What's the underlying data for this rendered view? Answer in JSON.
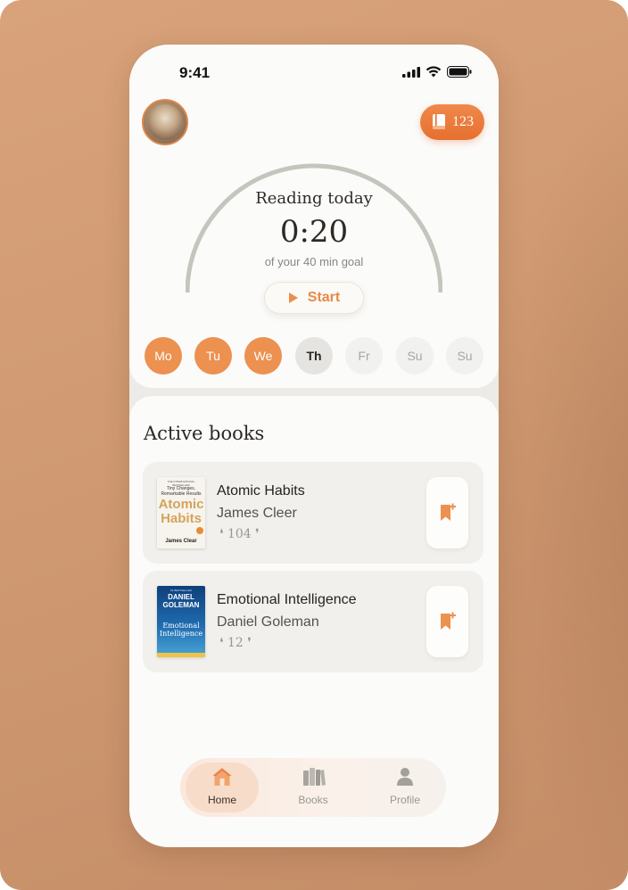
{
  "status_bar": {
    "time": "9:41"
  },
  "header": {
    "books_count": "123"
  },
  "reading": {
    "label": "Reading today",
    "time": "0:20",
    "goal_text": "of your 40 min goal",
    "progress_fraction": 0.5,
    "start_label": "Start"
  },
  "days": [
    {
      "label": "Mo",
      "state": "done"
    },
    {
      "label": "Tu",
      "state": "done"
    },
    {
      "label": "We",
      "state": "done"
    },
    {
      "label": "Th",
      "state": "today"
    },
    {
      "label": "Fr",
      "state": "future"
    },
    {
      "label": "Su",
      "state": "future"
    },
    {
      "label": "Su",
      "state": "future"
    }
  ],
  "section_title": "Active books",
  "books": [
    {
      "title": "Atomic Habits",
      "author": "James Cleer",
      "quotes": "104",
      "cover": {
        "top": "THE INTERNATIONAL BESTSELLER",
        "subtitle": "Tiny Changes, Remarkable Results",
        "title": "Atomic Habits",
        "author": "James Clear"
      }
    },
    {
      "title": "Emotional Intelligence",
      "author": "Daniel Goleman",
      "quotes": "12",
      "cover": {
        "top": "#1 BESTSELLER",
        "author": "DANIEL GOLEMAN",
        "title": "Emotional Intelligence"
      }
    }
  ],
  "tabbar": {
    "items": [
      {
        "label": "Home",
        "icon": "home-icon",
        "active": true
      },
      {
        "label": "Books",
        "icon": "books-icon",
        "active": false
      },
      {
        "label": "Profile",
        "icon": "profile-icon",
        "active": false
      }
    ]
  },
  "colors": {
    "accent": "#EC9150",
    "accent_dark": "#E6702F",
    "background": "#CF9870",
    "card": "#FBFBFA"
  }
}
